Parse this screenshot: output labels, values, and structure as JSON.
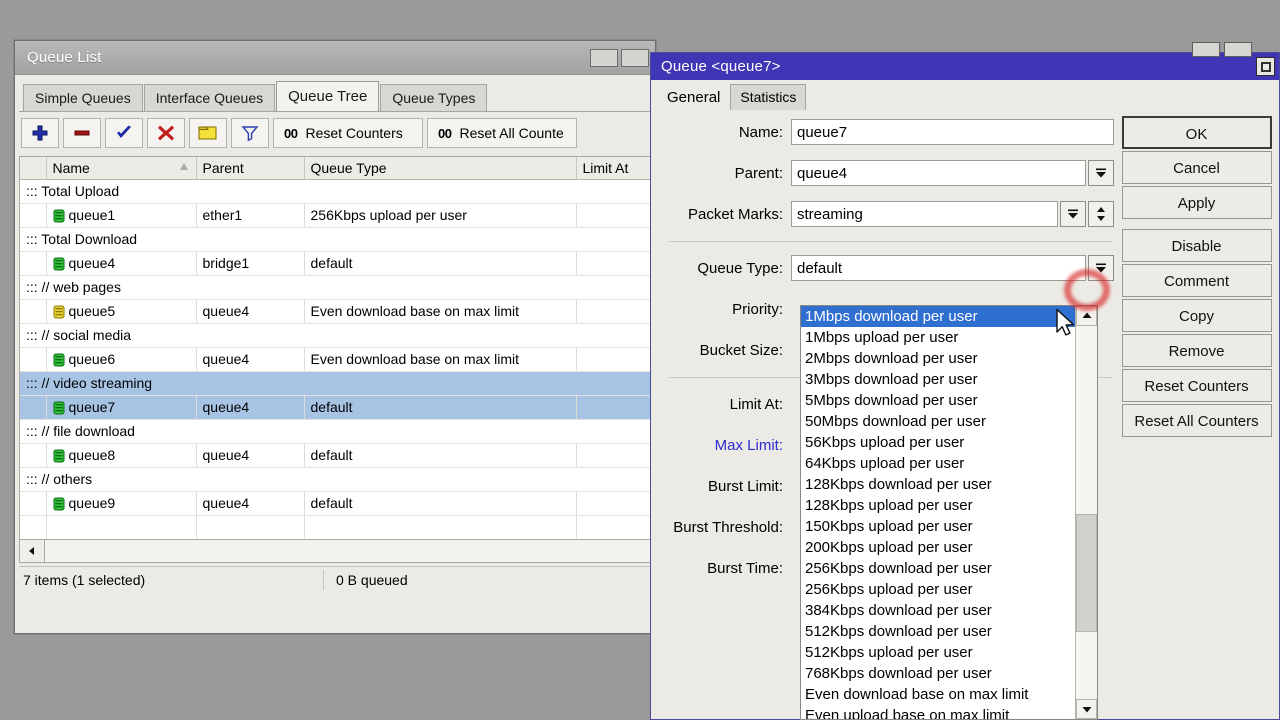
{
  "queue_list_window": {
    "title": "Queue List",
    "tabs": [
      {
        "label": "Simple Queues",
        "active": false
      },
      {
        "label": "Interface Queues",
        "active": false
      },
      {
        "label": "Queue Tree",
        "active": true
      },
      {
        "label": "Queue Types",
        "active": false
      }
    ],
    "toolbar": {
      "add_label": "+",
      "remove_label": "-",
      "enable_label": "check",
      "disable_label": "x",
      "comment_label": "comment",
      "filter_label": "filter",
      "reset_counters_label": "Reset Counters",
      "reset_all_counters_label": "Reset All Counte",
      "counter_prefix": "00"
    },
    "columns": [
      "",
      "Name",
      "Parent",
      "Queue Type",
      "Limit At"
    ],
    "rows": [
      {
        "type": "comment",
        "text": "::: Total Upload"
      },
      {
        "type": "queue",
        "indent": 1,
        "icon": "green",
        "name": "queue1",
        "parent": "ether1",
        "queue_type": "256Kbps upload per user",
        "limit_at": ""
      },
      {
        "type": "comment",
        "text": "::: Total  Download"
      },
      {
        "type": "queue",
        "indent": 1,
        "icon": "green",
        "name": "queue4",
        "parent": "bridge1",
        "queue_type": "default",
        "limit_at": ""
      },
      {
        "type": "comment",
        "text": "::: // web pages"
      },
      {
        "type": "queue",
        "indent": 2,
        "icon": "yellow",
        "name": "queue5",
        "parent": "queue4",
        "queue_type": "Even download base on max limit",
        "limit_at": ""
      },
      {
        "type": "comment",
        "text": "::: // social media"
      },
      {
        "type": "queue",
        "indent": 2,
        "icon": "green",
        "name": "queue6",
        "parent": "queue4",
        "queue_type": "Even download base on max limit",
        "limit_at": ""
      },
      {
        "type": "comment",
        "text": "::: // video streaming",
        "selected": true
      },
      {
        "type": "queue",
        "indent": 2,
        "icon": "green",
        "name": "queue7",
        "parent": "queue4",
        "queue_type": "default",
        "limit_at": "",
        "selected": true
      },
      {
        "type": "comment",
        "text": "::: // file download"
      },
      {
        "type": "queue",
        "indent": 2,
        "icon": "green",
        "name": "queue8",
        "parent": "queue4",
        "queue_type": "default",
        "limit_at": ""
      },
      {
        "type": "comment",
        "text": "::: // others"
      },
      {
        "type": "queue",
        "indent": 2,
        "icon": "green",
        "name": "queue9",
        "parent": "queue4",
        "queue_type": "default",
        "limit_at": ""
      }
    ],
    "statusbar": {
      "items_text": "7 items (1 selected)",
      "queued_text": "0 B queued"
    }
  },
  "queue_dialog": {
    "title": "Queue <queue7>",
    "tabs": [
      {
        "label": "General",
        "active": true
      },
      {
        "label": "Statistics",
        "active": false
      }
    ],
    "fields": {
      "name_label": "Name:",
      "name_value": "queue7",
      "parent_label": "Parent:",
      "parent_value": "queue4",
      "packet_marks_label": "Packet Marks:",
      "packet_marks_value": "streaming",
      "queue_type_label": "Queue Type:",
      "queue_type_value": "default",
      "priority_label": "Priority:",
      "bucket_size_label": "Bucket Size:",
      "limit_at_label": "Limit At:",
      "max_limit_label": "Max Limit:",
      "burst_limit_label": "Burst Limit:",
      "burst_threshold_label": "Burst Threshold:",
      "burst_time_label": "Burst Time:"
    },
    "buttons": [
      {
        "label": "OK",
        "default": true
      },
      {
        "label": "Cancel",
        "default": false
      },
      {
        "label": "Apply",
        "default": false
      },
      {
        "label": "Disable",
        "default": false,
        "gap": true
      },
      {
        "label": "Comment",
        "default": false
      },
      {
        "label": "Copy",
        "default": false
      },
      {
        "label": "Remove",
        "default": false
      },
      {
        "label": "Reset Counters",
        "default": false
      },
      {
        "label": "Reset All Counters",
        "default": false
      }
    ],
    "queue_type_dropdown": {
      "selected_index": 0,
      "options": [
        "1Mbps download per user",
        "1Mbps upload per user",
        "2Mbps download per user",
        "3Mbps download per user",
        "5Mbps download per user",
        "50Mbps download per user",
        "56Kbps upload per user",
        "64Kbps upload per user",
        "128Kbps download per user",
        "128Kbps upload per user",
        "150Kbps upload per user",
        "200Kbps upload per user",
        "256Kbps download per user",
        "256Kbps upload per user",
        "384Kbps download per user",
        "512Kbps download per user",
        "512Kbps upload per user",
        "768Kbps download per user",
        "Even download base on max limit",
        "Even upload  base on max limit"
      ]
    }
  },
  "colors": {
    "dialog_titlebar": "#3f35b5",
    "selection": "#a8c4e4",
    "dropdown_selection": "#2f6fd0",
    "highlight_circle": "#d62222",
    "link_label": "#2b2bd0"
  }
}
